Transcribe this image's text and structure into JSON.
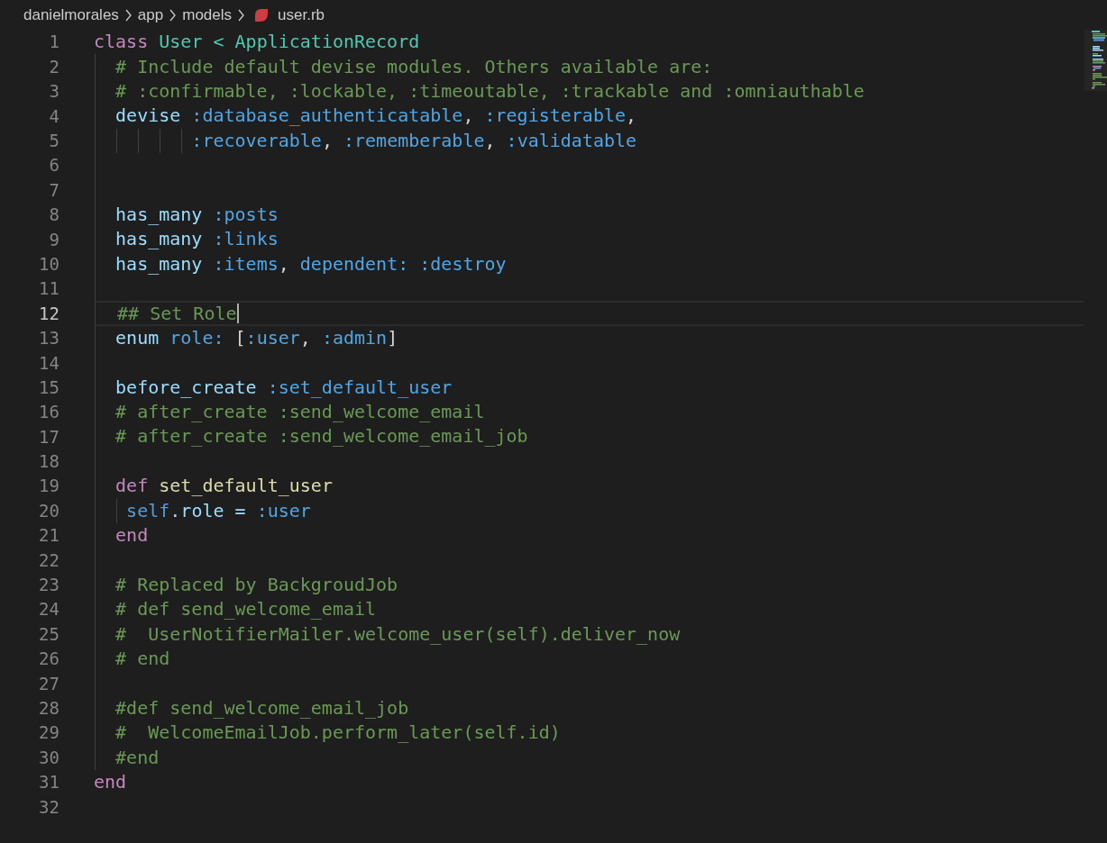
{
  "breadcrumb": {
    "folders": [
      "danielmorales",
      "app",
      "models"
    ],
    "file": "user.rb"
  },
  "lines": [
    {
      "number": "1",
      "current": false,
      "tokens": [
        {
          "text": "class",
          "kind": "keyword"
        },
        {
          "text": " User < ApplicationRecord",
          "kind": "type"
        }
      ]
    },
    {
      "number": "2",
      "current": false,
      "tokens": [
        {
          "text": "  # Include default devise modules. Others available are:",
          "kind": "comment"
        }
      ]
    },
    {
      "number": "3",
      "current": false,
      "tokens": [
        {
          "text": "  # :confirmable, :lockable, :timeoutable, :trackable and :omniauthable",
          "kind": "comment"
        }
      ]
    },
    {
      "number": "4",
      "current": false,
      "tokens": [
        {
          "text": "  devise",
          "kind": "method"
        },
        {
          "text": " :database_authenticatable",
          "kind": "symbol"
        },
        {
          "text": ",",
          "kind": "plain"
        },
        {
          "text": " :registerable",
          "kind": "symbol"
        },
        {
          "text": ",",
          "kind": "plain"
        }
      ]
    },
    {
      "number": "5",
      "current": false,
      "tokens": [
        {
          "text": "         :recoverable",
          "kind": "symbol"
        },
        {
          "text": ",",
          "kind": "plain"
        },
        {
          "text": " :rememberable",
          "kind": "symbol"
        },
        {
          "text": ",",
          "kind": "plain"
        },
        {
          "text": " :validatable",
          "kind": "symbol"
        }
      ]
    },
    {
      "number": "6",
      "current": false
    },
    {
      "number": "7",
      "current": false
    },
    {
      "number": "8",
      "current": false,
      "tokens": [
        {
          "text": "  has_many",
          "kind": "method"
        },
        {
          "text": " :posts",
          "kind": "symbol"
        }
      ]
    },
    {
      "number": "9",
      "current": false,
      "tokens": [
        {
          "text": "  has_many",
          "kind": "method"
        },
        {
          "text": " :links",
          "kind": "symbol"
        }
      ]
    },
    {
      "number": "10",
      "current": false,
      "tokens": [
        {
          "text": "  has_many",
          "kind": "method"
        },
        {
          "text": " :items",
          "kind": "symbol"
        },
        {
          "text": ",",
          "kind": "plain"
        },
        {
          "text": " dependent: :destroy",
          "kind": "symbol"
        }
      ]
    },
    {
      "number": "11",
      "current": false
    },
    {
      "number": "12",
      "current": true,
      "tokens": [
        {
          "text": "  ## Set Role",
          "kind": "comment"
        }
      ]
    },
    {
      "number": "13",
      "current": false,
      "tokens": [
        {
          "text": "  enum",
          "kind": "method"
        },
        {
          "text": " role:",
          "kind": "symbol"
        },
        {
          "text": " [",
          "kind": "plain"
        },
        {
          "text": ":user",
          "kind": "symbol"
        },
        {
          "text": ",",
          "kind": "plain"
        },
        {
          "text": " :admin",
          "kind": "symbol"
        },
        {
          "text": "]",
          "kind": "plain"
        }
      ]
    },
    {
      "number": "14",
      "current": false
    },
    {
      "number": "15",
      "current": false,
      "tokens": [
        {
          "text": "  before_create",
          "kind": "method"
        },
        {
          "text": " :set_default_user",
          "kind": "symbol"
        }
      ]
    },
    {
      "number": "16",
      "current": false,
      "tokens": [
        {
          "text": "  # after_create :send_welcome_email",
          "kind": "comment"
        }
      ]
    },
    {
      "number": "17",
      "current": false,
      "tokens": [
        {
          "text": "  # after_create :send_welcome_email_job",
          "kind": "comment"
        }
      ]
    },
    {
      "number": "18",
      "current": false
    },
    {
      "number": "19",
      "current": false,
      "tokens": [
        {
          "text": "  def",
          "kind": "keyword"
        },
        {
          "text": " set_default_user",
          "kind": "function"
        }
      ]
    },
    {
      "number": "20",
      "current": false,
      "tokens": [
        {
          "text": "   self",
          "kind": "self"
        },
        {
          "text": ".role = ",
          "kind": "method"
        },
        {
          "text": ":user",
          "kind": "symbol"
        }
      ]
    },
    {
      "number": "21",
      "current": false,
      "tokens": [
        {
          "text": "  end",
          "kind": "keyword"
        }
      ]
    },
    {
      "number": "22",
      "current": false
    },
    {
      "number": "23",
      "current": false,
      "tokens": [
        {
          "text": "  # Replaced by BackgroudJob",
          "kind": "comment"
        }
      ]
    },
    {
      "number": "24",
      "current": false,
      "tokens": [
        {
          "text": "  # def send_welcome_email",
          "kind": "comment"
        }
      ]
    },
    {
      "number": "25",
      "current": false,
      "tokens": [
        {
          "text": "  #  UserNotifierMailer.welcome_user(self).deliver_now",
          "kind": "comment"
        }
      ]
    },
    {
      "number": "26",
      "current": false,
      "tokens": [
        {
          "text": "  # end",
          "kind": "comment"
        }
      ]
    },
    {
      "number": "27",
      "current": false
    },
    {
      "number": "28",
      "current": false,
      "tokens": [
        {
          "text": "  #def send_welcome_email_job",
          "kind": "comment"
        }
      ]
    },
    {
      "number": "29",
      "current": false,
      "tokens": [
        {
          "text": "  #  WelcomeEmailJob.perform_later(self.id)",
          "kind": "comment"
        }
      ]
    },
    {
      "number": "30",
      "current": false,
      "tokens": [
        {
          "text": "  #end",
          "kind": "comment"
        }
      ]
    },
    {
      "number": "31",
      "current": false,
      "tokens": [
        {
          "text": "end",
          "kind": "keyword"
        }
      ]
    },
    {
      "number": "32",
      "current": false
    }
  ]
}
